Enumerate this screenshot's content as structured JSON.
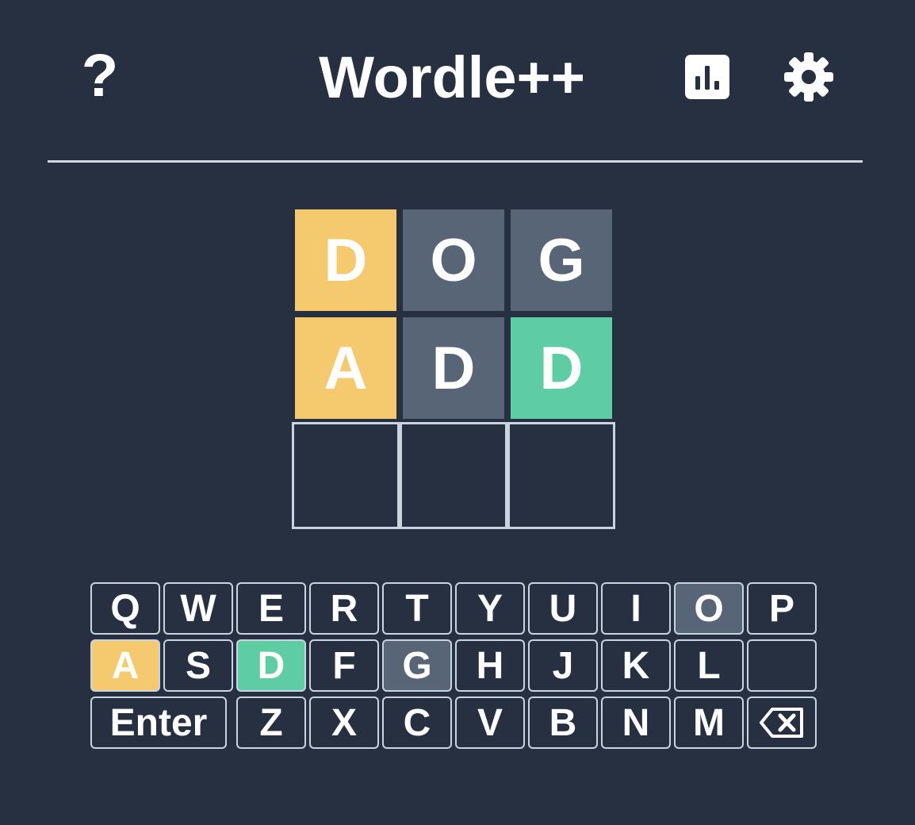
{
  "header": {
    "help_label": "?",
    "title": "Wordle++",
    "stats_icon": "bar-chart-icon",
    "settings_icon": "gear-icon"
  },
  "board": {
    "rows": [
      [
        {
          "letter": "D",
          "state": "present"
        },
        {
          "letter": "O",
          "state": "absent"
        },
        {
          "letter": "G",
          "state": "absent"
        }
      ],
      [
        {
          "letter": "A",
          "state": "present"
        },
        {
          "letter": "D",
          "state": "absent"
        },
        {
          "letter": "D",
          "state": "correct"
        }
      ],
      [
        {
          "letter": "",
          "state": "empty"
        },
        {
          "letter": "",
          "state": "empty"
        },
        {
          "letter": "",
          "state": "empty"
        }
      ]
    ]
  },
  "keyboard": {
    "row1": [
      {
        "label": "Q",
        "state": ""
      },
      {
        "label": "W",
        "state": ""
      },
      {
        "label": "E",
        "state": ""
      },
      {
        "label": "R",
        "state": ""
      },
      {
        "label": "T",
        "state": ""
      },
      {
        "label": "Y",
        "state": ""
      },
      {
        "label": "U",
        "state": ""
      },
      {
        "label": "I",
        "state": ""
      },
      {
        "label": "O",
        "state": "absent"
      },
      {
        "label": "P",
        "state": ""
      }
    ],
    "row2": [
      {
        "label": "A",
        "state": "present"
      },
      {
        "label": "S",
        "state": ""
      },
      {
        "label": "D",
        "state": "correct"
      },
      {
        "label": "F",
        "state": ""
      },
      {
        "label": "G",
        "state": "absent"
      },
      {
        "label": "H",
        "state": ""
      },
      {
        "label": "J",
        "state": ""
      },
      {
        "label": "K",
        "state": ""
      },
      {
        "label": "L",
        "state": ""
      },
      {
        "label": "",
        "state": ""
      }
    ],
    "row3": [
      {
        "label": "Enter",
        "state": ""
      },
      {
        "label": "Z",
        "state": ""
      },
      {
        "label": "X",
        "state": ""
      },
      {
        "label": "C",
        "state": ""
      },
      {
        "label": "V",
        "state": ""
      },
      {
        "label": "B",
        "state": ""
      },
      {
        "label": "N",
        "state": ""
      },
      {
        "label": "M",
        "state": ""
      }
    ],
    "backspace_icon": "backspace-icon"
  },
  "colors": {
    "background": "#263040",
    "present": "#f5c96d",
    "absent": "#586577",
    "correct": "#5ecca5",
    "border": "#c9d4e0"
  }
}
